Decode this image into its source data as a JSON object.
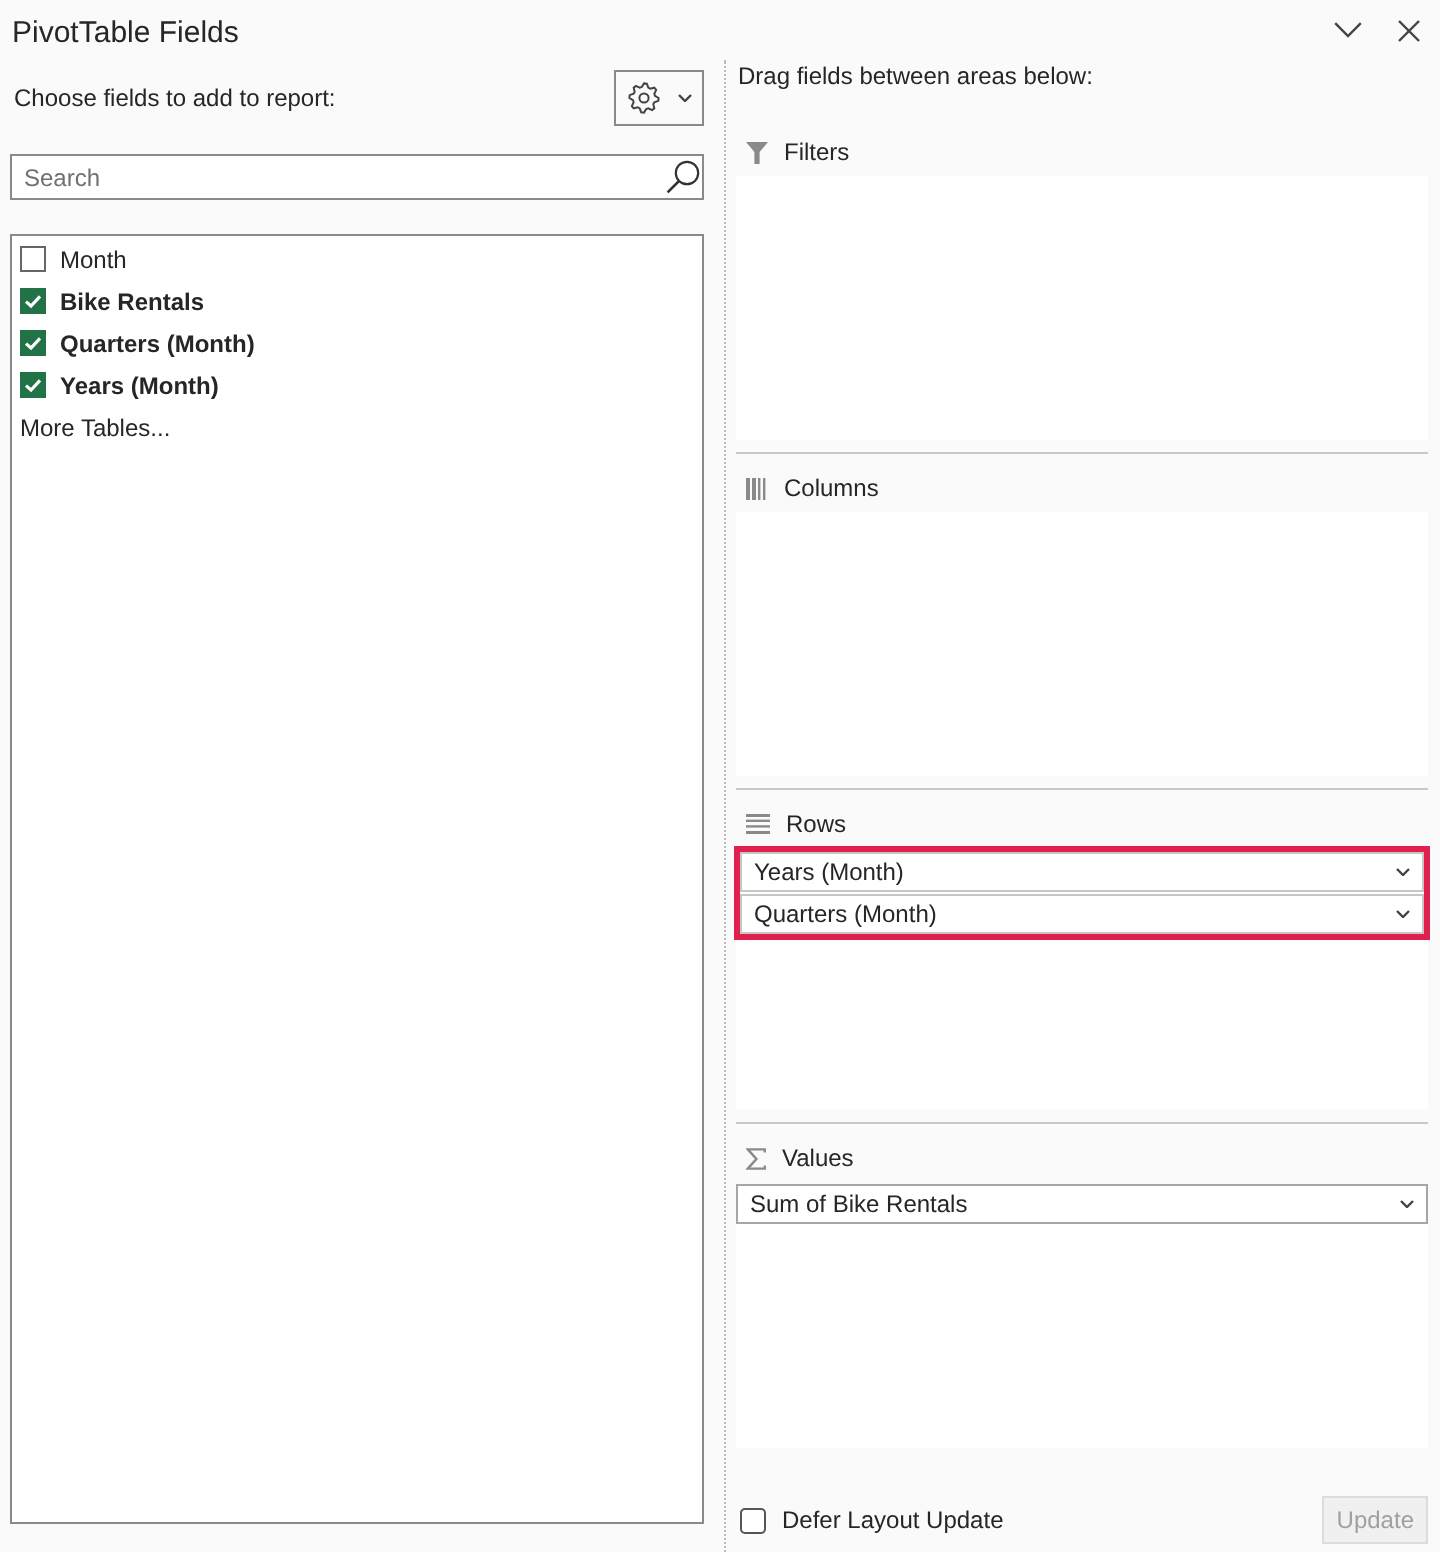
{
  "panel": {
    "title": "PivotTable Fields"
  },
  "field_list": {
    "label": "Choose fields to add to report:",
    "search": {
      "placeholder": "Search"
    },
    "fields": [
      {
        "name": "Month",
        "checked": false
      },
      {
        "name": "Bike Rentals",
        "checked": true
      },
      {
        "name": "Quarters (Month)",
        "checked": true
      },
      {
        "name": "Years (Month)",
        "checked": true
      }
    ],
    "more_link": "More Tables..."
  },
  "areas_label": "Drag fields between areas below:",
  "areas": [
    {
      "kind": "filters",
      "label": "Filters",
      "highlighted": false
    },
    {
      "kind": "columns",
      "label": "Columns",
      "highlighted": false
    },
    {
      "kind": "rows",
      "label": "Rows",
      "highlighted": true,
      "items": [
        "Years (Month)",
        "Quarters (Month)"
      ]
    },
    {
      "kind": "values",
      "label": "Values",
      "highlighted": false,
      "items": [
        "Sum of Bike Rentals"
      ]
    }
  ],
  "defer_update": {
    "label": "Defer Layout Update",
    "checked": false
  },
  "update_button": {
    "label": "Update",
    "disabled": true
  }
}
